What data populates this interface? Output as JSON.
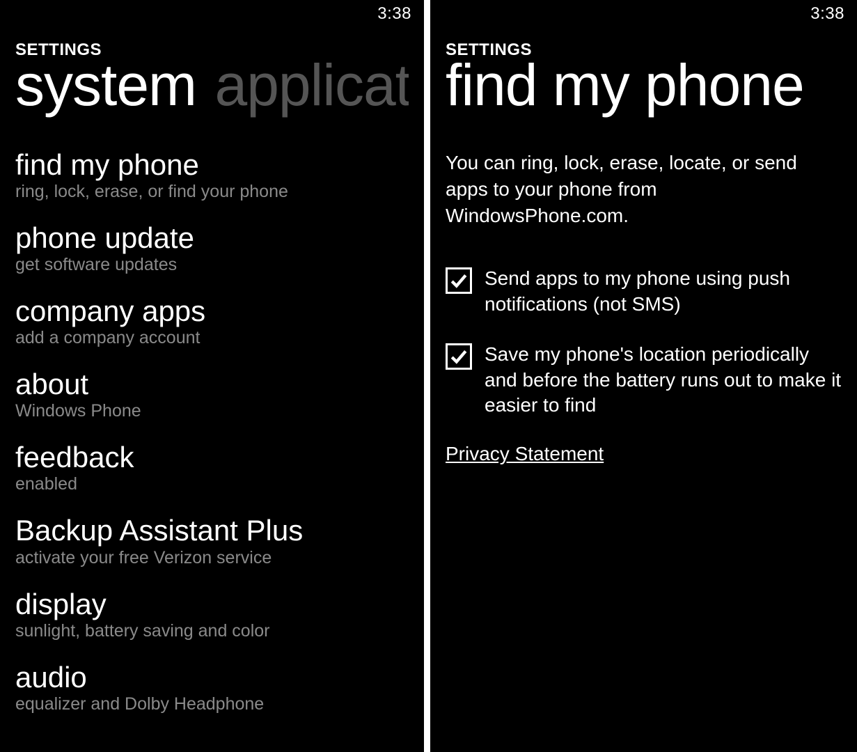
{
  "statusbar": {
    "time": "3:38"
  },
  "left": {
    "appTitle": "SETTINGS",
    "pivot": {
      "active": "system",
      "inactive": "applicat"
    },
    "items": [
      {
        "title": "find my phone",
        "sub": "ring, lock, erase, or find your phone"
      },
      {
        "title": "phone update",
        "sub": "get software updates"
      },
      {
        "title": "company apps",
        "sub": "add a company account"
      },
      {
        "title": "about",
        "sub": "Windows Phone"
      },
      {
        "title": "feedback",
        "sub": "enabled"
      },
      {
        "title": "Backup Assistant Plus",
        "sub": "activate your free Verizon service"
      },
      {
        "title": "display",
        "sub": "sunlight, battery saving and color"
      },
      {
        "title": "audio",
        "sub": "equalizer and Dolby Headphone"
      }
    ]
  },
  "right": {
    "appTitle": "SETTINGS",
    "pageTitle": "find my phone",
    "description": "You can ring, lock, erase, locate, or send apps to your phone from WindowsPhone.com.",
    "checks": [
      {
        "checked": true,
        "label": "Send apps to my phone using push notifications (not SMS)"
      },
      {
        "checked": true,
        "label": "Save my phone's location periodically and before the battery runs out to make it easier to find"
      }
    ],
    "privacyLink": "Privacy Statement"
  }
}
